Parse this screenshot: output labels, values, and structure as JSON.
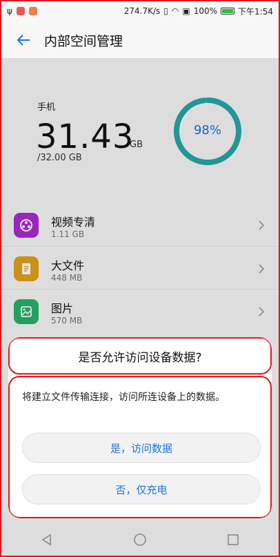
{
  "status": {
    "speed": "274.7K/s",
    "battery_pct": "100%",
    "time": "下午1:54"
  },
  "appbar": {
    "title": "内部空间管理"
  },
  "summary": {
    "device_label": "手机",
    "used": "31.43",
    "used_unit": "GB",
    "total": "/32.00 GB",
    "percent_text": "98%",
    "percent_value": 0.98
  },
  "items": [
    {
      "title": "视频专清",
      "size": "1.11 GB",
      "icon": "video-clean-icon",
      "color": "#a92cd1"
    },
    {
      "title": "大文件",
      "size": "448 MB",
      "icon": "large-file-icon",
      "color": "#e3a21b"
    },
    {
      "title": "图片",
      "size": "570 MB",
      "icon": "image-icon",
      "color": "#27b36b"
    }
  ],
  "dialog": {
    "title": "是否允许访问设备数据?",
    "message": "将建立文件传输连接，访问所连设备上的数据。",
    "allow_label": "是，访问数据",
    "deny_label": "否，仅充电"
  },
  "colors": {
    "accent": "#1a73e8",
    "ring": "#26a8a8",
    "highlight": "#e4161c"
  }
}
